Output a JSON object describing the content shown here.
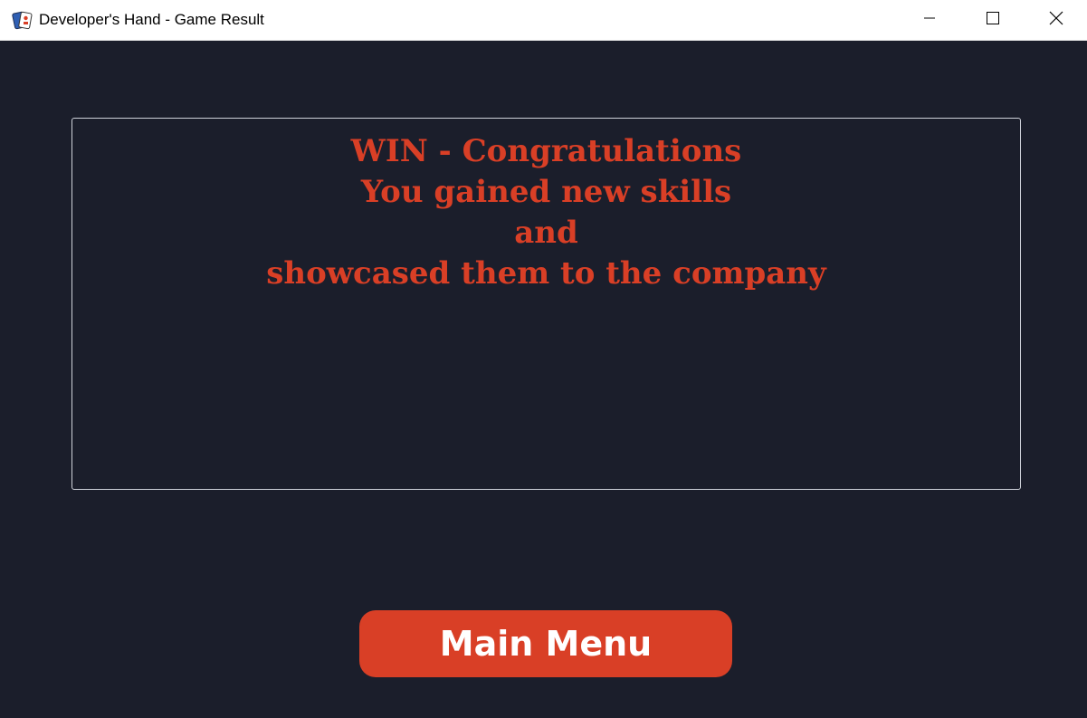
{
  "window": {
    "title": "Developer's Hand - Game Result",
    "app_icon": "playing-cards-icon",
    "controls": [
      "minimize-icon",
      "maximize-icon",
      "close-icon"
    ]
  },
  "result": {
    "lines": [
      "WIN - Congratulations",
      "You gained new skills",
      "and",
      "showcased them to the company"
    ]
  },
  "main_menu_button": {
    "label": "Main Menu"
  },
  "colors": {
    "background": "#1b1e2b",
    "accent": "#d93f26",
    "text_on_accent": "#ffffff",
    "border": "#cfd2da"
  }
}
